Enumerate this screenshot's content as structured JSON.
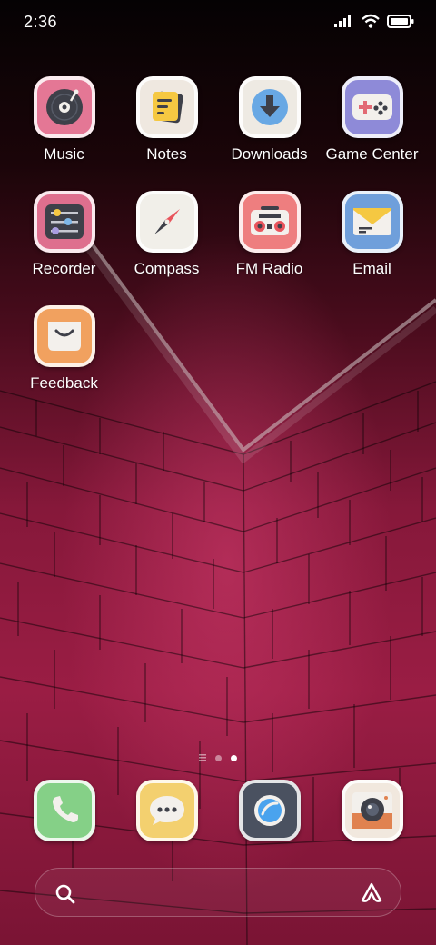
{
  "status_bar": {
    "time": "2:36"
  },
  "apps": [
    {
      "label": "Music"
    },
    {
      "label": "Notes"
    },
    {
      "label": "Downloads"
    },
    {
      "label": "Game Center"
    },
    {
      "label": "Recorder"
    },
    {
      "label": "Compass"
    },
    {
      "label": "FM Radio"
    },
    {
      "label": "Email"
    },
    {
      "label": "Feedback"
    }
  ],
  "page_indicator": {
    "pages": 2,
    "current": 2
  },
  "dock": [
    {
      "icon": "phone-icon"
    },
    {
      "icon": "messages-icon"
    },
    {
      "icon": "browser-icon"
    },
    {
      "icon": "camera-icon"
    }
  ],
  "colors": {
    "music": "#e47795",
    "notes": "#efe8e0",
    "downloads": "#eeeae3",
    "game_center": "#8e8ad8",
    "recorder": "#de6f8e",
    "compass": "#f1efe9",
    "fm_radio": "#ee7e7f",
    "email": "#6f9fdb",
    "feedback": "#f1a15f",
    "phone": "#85d087",
    "messages": "#f3d06f",
    "browser": "#4a5160",
    "camera": "#f1e8de"
  }
}
